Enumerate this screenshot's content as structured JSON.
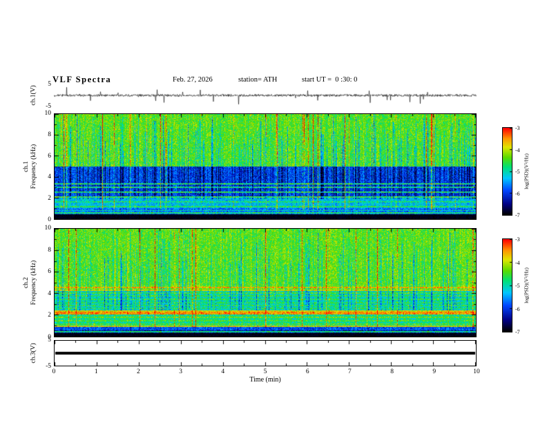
{
  "header": {
    "title": "VLF  Spectra",
    "date": "Feb. 27, 2026",
    "station": "station= ATH",
    "start_ut": "start UT =  0 :30: 0"
  },
  "time_axis": {
    "label": "Time  (min)",
    "min": 0,
    "max": 10,
    "ticks": [
      0,
      1,
      2,
      3,
      4,
      5,
      6,
      7,
      8,
      9,
      10
    ]
  },
  "colorbar": {
    "label": "log(PSD)(V²/Hz)",
    "min": -7,
    "max": -3,
    "ticks": [
      -3,
      -4,
      -5,
      -6,
      -7
    ]
  },
  "chart_data": [
    {
      "type": "line",
      "name": "ch1-voltage-waveform",
      "ylabel": "ch.1(V)",
      "ylim": [
        -5,
        5
      ],
      "yticks": [
        5,
        -5
      ],
      "xlim": [
        0,
        10
      ],
      "description": "Broadband noise near 0 V with frequent impulsive spikes up to about ±4 V across the full 10 minute record"
    },
    {
      "type": "heatmap",
      "name": "ch1-spectrogram",
      "ylabel": "ch.1",
      "ylabel2": "Frequency  (kHz)",
      "ylim": [
        0,
        10
      ],
      "yticks": [
        0,
        2,
        4,
        6,
        8,
        10
      ],
      "xlim": [
        0,
        10
      ],
      "value_range": [
        -7,
        -3
      ],
      "bands": [
        {
          "f0": 5.0,
          "f1": 10.0,
          "v": -4.4
        },
        {
          "f0": 2.0,
          "f1": 5.0,
          "v": -5.9
        },
        {
          "f0": 1.0,
          "f1": 2.0,
          "v": -5.3
        },
        {
          "f0": 0.45,
          "f1": 1.0,
          "v": -5.7
        },
        {
          "f0": 0.0,
          "f1": 0.45,
          "v": -7.0
        }
      ],
      "lines": [
        {
          "f": 3.35,
          "v": -4.6
        },
        {
          "f": 3.0,
          "v": -4.7
        },
        {
          "f": 2.55,
          "v": -4.6
        },
        {
          "f": 2.1,
          "v": -4.5
        },
        {
          "f": 1.6,
          "v": -4.8
        },
        {
          "f": 1.15,
          "v": -4.7
        },
        {
          "f": 0.8,
          "v": -5.0
        },
        {
          "f": 0.55,
          "v": -4.8
        }
      ],
      "streaks": {
        "blue_prob": 0.3,
        "bright_prob": 0.05,
        "blue_floor": 1.9
      },
      "description": "Green/yellow background above 5 kHz with dense dark-blue vertical striations between 2 and 5 kHz, bright sferic columns, cyan horizontal hum lines between 0.5 and 3.5 kHz, and a black band below 0.45 kHz"
    },
    {
      "type": "heatmap",
      "name": "ch2-spectrogram",
      "ylabel": "ch.2",
      "ylabel2": "Frequency  (kHz)",
      "ylim": [
        0,
        10
      ],
      "yticks": [
        0,
        2,
        4,
        6,
        8,
        10
      ],
      "xlim": [
        0,
        10
      ],
      "value_range": [
        -7,
        -3
      ],
      "bands": [
        {
          "f0": 4.75,
          "f1": 10.0,
          "v": -4.4
        },
        {
          "f0": 4.35,
          "f1": 4.75,
          "v": -4.3
        },
        {
          "f0": 2.45,
          "f1": 4.35,
          "v": -5.0
        },
        {
          "f0": 2.0,
          "f1": 2.45,
          "v": -3.9
        },
        {
          "f0": 0.9,
          "f1": 2.0,
          "v": -4.9
        },
        {
          "f0": 0.55,
          "f1": 0.9,
          "v": -5.9
        },
        {
          "f0": 0.28,
          "f1": 0.55,
          "v": -6.5
        },
        {
          "f0": 0.0,
          "f1": 0.28,
          "v": -7.0
        }
      ],
      "lines": [
        {
          "f": 4.55,
          "v": -3.6,
          "w": 0.07
        },
        {
          "f": 4.3,
          "v": -3.9
        },
        {
          "f": 4.05,
          "v": -4.5
        },
        {
          "f": 3.75,
          "v": -4.6
        },
        {
          "f": 3.45,
          "v": -4.6
        },
        {
          "f": 3.15,
          "v": -4.7
        },
        {
          "f": 2.85,
          "v": -4.6
        },
        {
          "f": 2.6,
          "v": -4.7
        },
        {
          "f": 2.15,
          "v": -3.5,
          "w": 0.12
        },
        {
          "f": 1.75,
          "v": -4.4
        },
        {
          "f": 1.45,
          "v": -4.5
        },
        {
          "f": 1.15,
          "v": -4.5
        },
        {
          "f": 0.95,
          "v": -3.9,
          "w": 0.07
        },
        {
          "f": 0.4,
          "v": -4.9
        }
      ],
      "streaks": {
        "blue_prob": 0.2,
        "bright_prob": 0.045,
        "blue_floor": 2.45
      },
      "description": "Green background above ~4.7 kHz with blue vertical striations, strong horizontal power-line harmonic banding below 4.7 kHz including orange lines near 4.5 and 2.15 kHz and a yellow band at 2.0–2.45 kHz, dark band below 0.9 kHz and black below 0.28 kHz"
    },
    {
      "type": "line",
      "name": "ch3-voltage-waveform",
      "ylabel": "ch.3(V)",
      "ylim": [
        -5,
        5
      ],
      "yticks": [
        5,
        -5
      ],
      "xlim": [
        0,
        10
      ],
      "value": 0,
      "description": "Constant flat thick black line at 0 V (no signal on channel 3)"
    }
  ]
}
